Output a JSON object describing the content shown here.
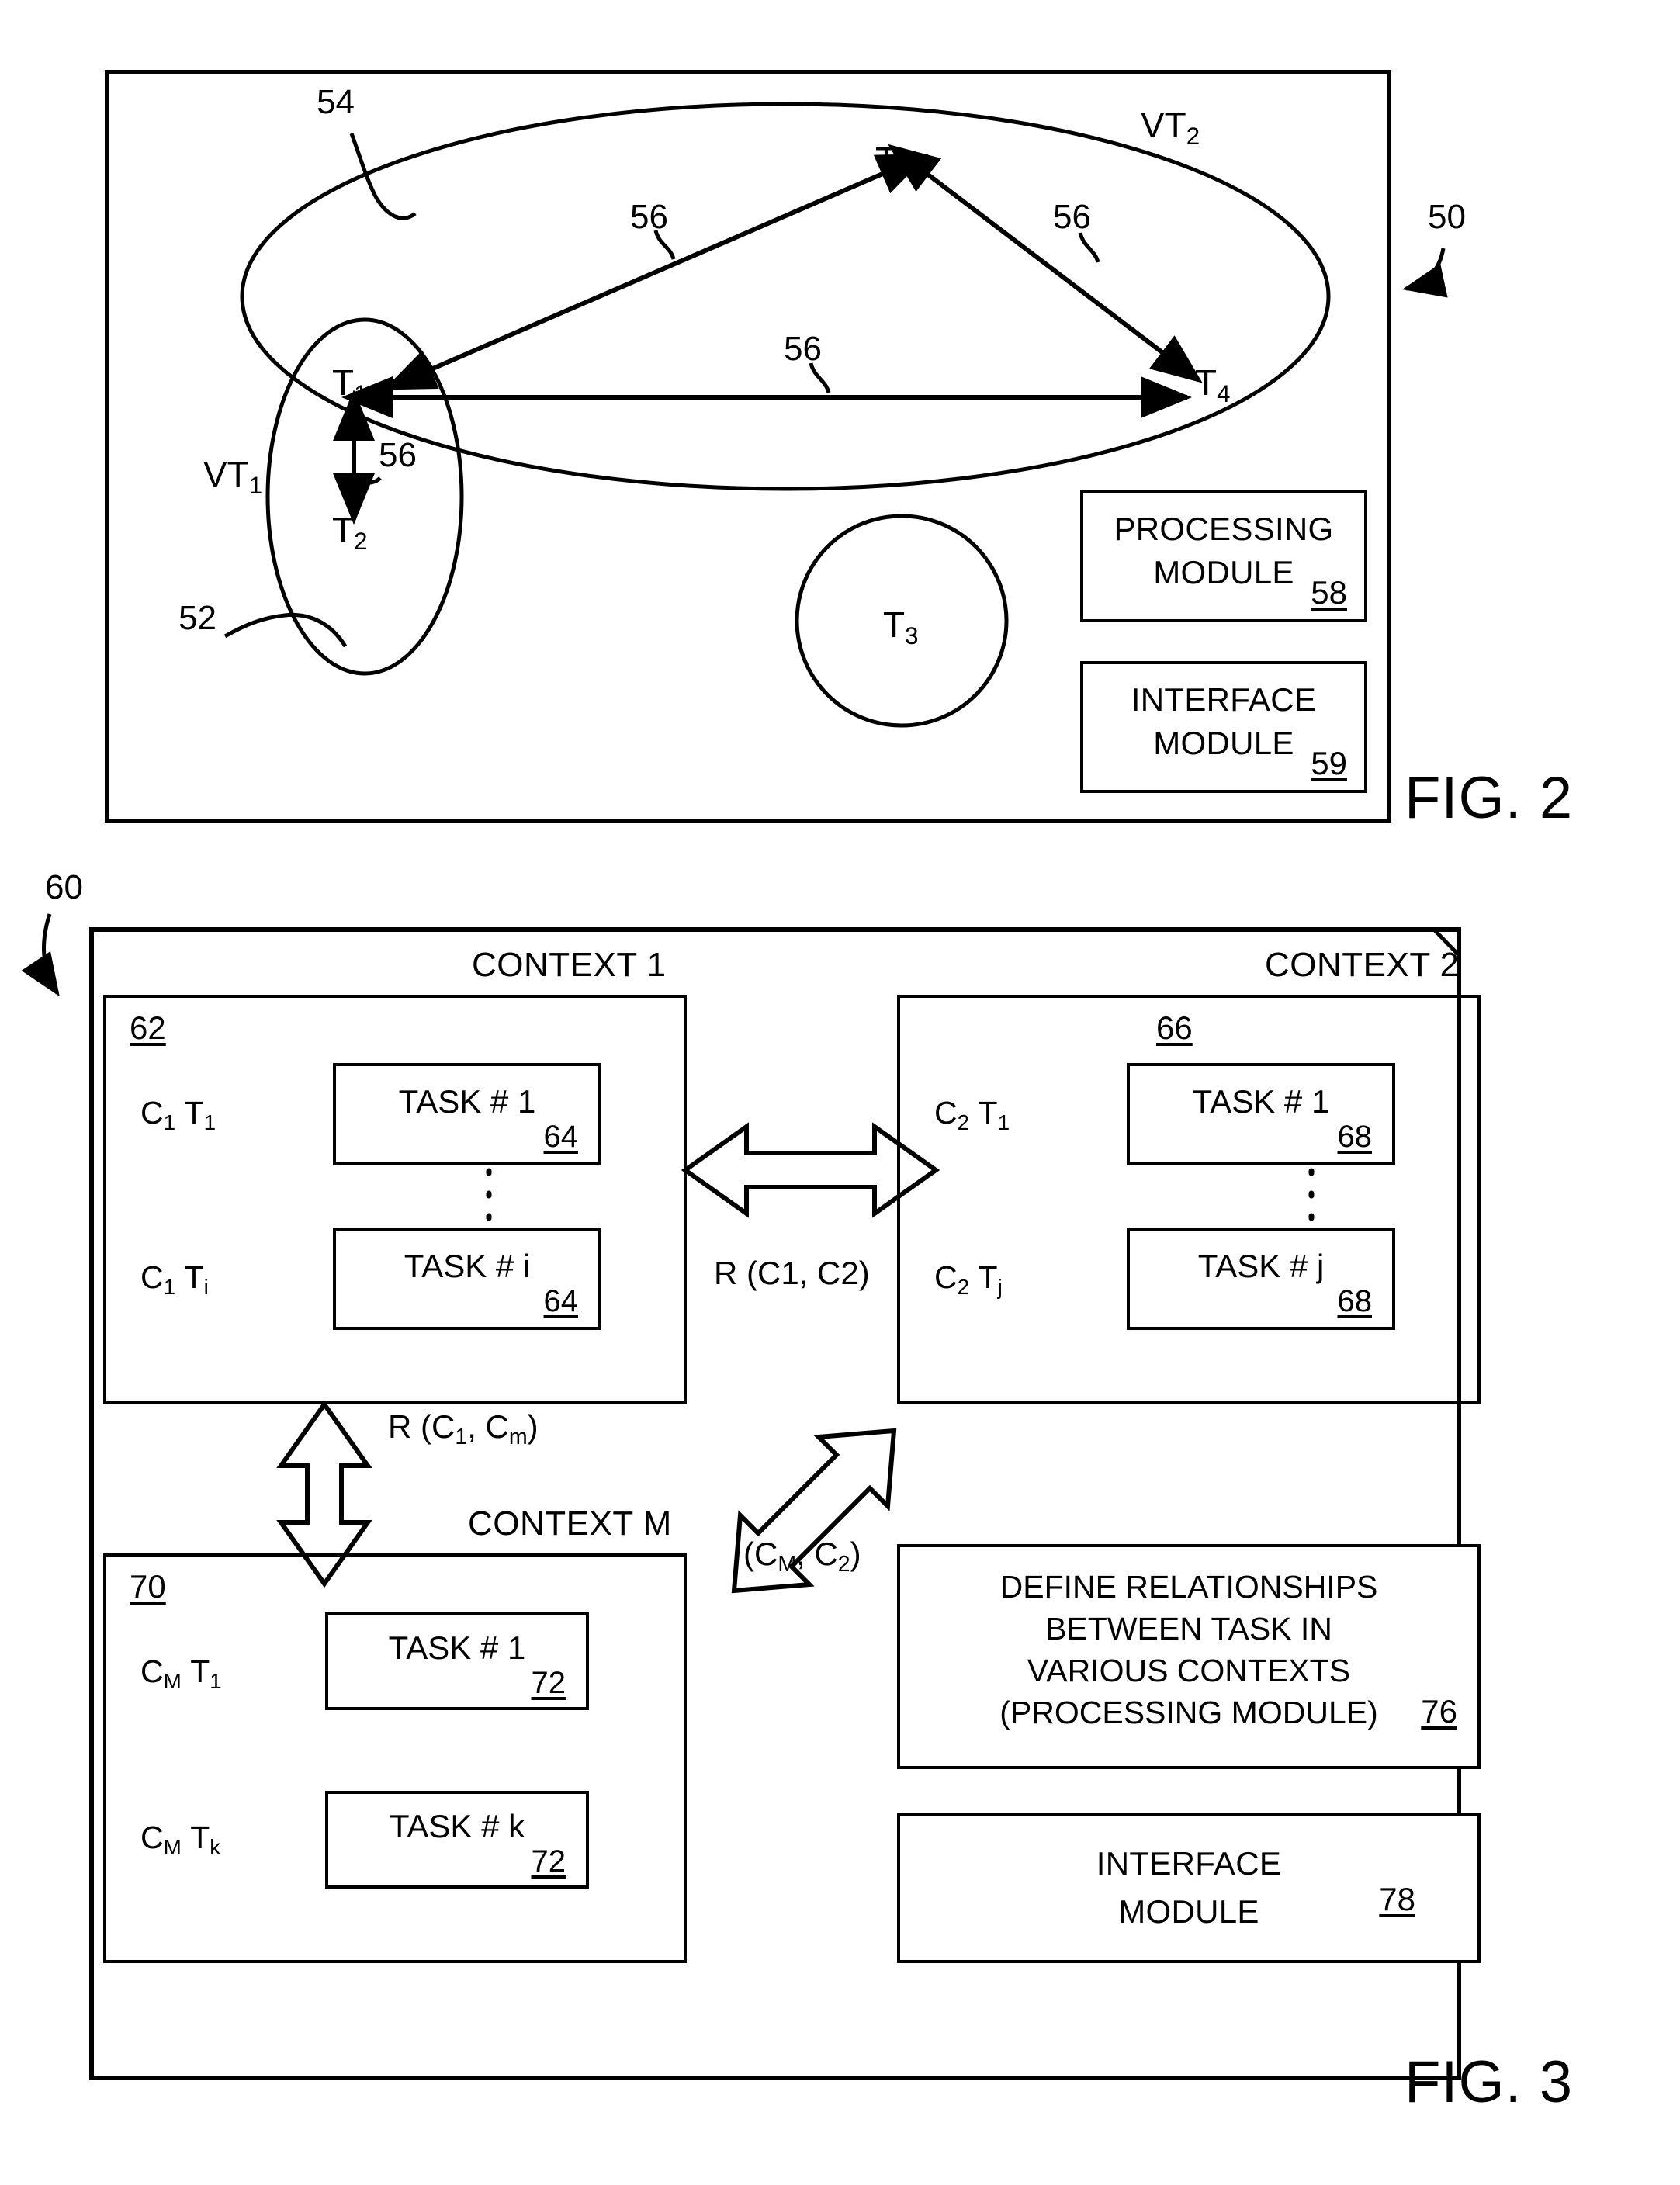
{
  "figures": [
    {
      "id": "fig2",
      "caption": "FIG. 2",
      "system_ref": "50",
      "ellipse_large_ref": "54",
      "ellipse_small_ref": "52",
      "group_labels": {
        "vt1": "VT",
        "vt1_sub": "1",
        "vt2": "VT",
        "vt2_sub": "2"
      },
      "nodes": [
        {
          "name": "T",
          "sub": "N"
        },
        {
          "name": "T",
          "sub": "1"
        },
        {
          "name": "T",
          "sub": "2"
        },
        {
          "name": "T",
          "sub": "3"
        },
        {
          "name": "T",
          "sub": "4"
        }
      ],
      "relation_refs": [
        "56",
        "56",
        "56",
        "56"
      ],
      "modules": [
        {
          "line1": "PROCESSING",
          "line2": "MODULE",
          "ref": "58"
        },
        {
          "line1": "INTERFACE",
          "line2": "MODULE",
          "ref": "59"
        }
      ]
    },
    {
      "id": "fig3",
      "caption": "FIG. 3",
      "system_ref": "60",
      "contexts": [
        {
          "title": "CONTEXT 1",
          "ref": "62",
          "rows": [
            {
              "label_c": "C",
              "label_c_sub": "1",
              "label_t": "T",
              "label_t_sub": "1",
              "task": "TASK # 1",
              "task_ref": "64"
            },
            {
              "label_c": "C",
              "label_c_sub": "1",
              "label_t": "T",
              "label_t_sub": "i",
              "task": "TASK # i",
              "task_ref": "64"
            }
          ]
        },
        {
          "title": "CONTEXT 2",
          "ref": "66",
          "rows": [
            {
              "label_c": "C",
              "label_c_sub": "2",
              "label_t": "T",
              "label_t_sub": "1",
              "task": "TASK # 1",
              "task_ref": "68"
            },
            {
              "label_c": "C",
              "label_c_sub": "2",
              "label_t": "T",
              "label_t_sub": "j",
              "task": "TASK # j",
              "task_ref": "68"
            }
          ]
        },
        {
          "title": "CONTEXT M",
          "ref": "70",
          "rows": [
            {
              "label_c": "C",
              "label_c_sub": "M",
              "label_t": "T",
              "label_t_sub": "1",
              "task": "TASK # 1",
              "task_ref": "72"
            },
            {
              "label_c": "C",
              "label_c_sub": "M",
              "label_t": "T",
              "label_t_sub": "k",
              "task": "TASK # k",
              "task_ref": "72"
            }
          ]
        }
      ],
      "relations": [
        {
          "id": "r-c1-c2",
          "text": "R (C1, C2)"
        },
        {
          "id": "r-c1-cm",
          "prefix": "R (C",
          "sub1": "1",
          "mid": ", C",
          "sub2": "m",
          "suffix": ")"
        },
        {
          "id": "r-cm-c2",
          "prefix": "(C",
          "sub1": "M",
          "mid": ", C",
          "sub2": "2",
          "suffix": ")"
        }
      ],
      "modules": [
        {
          "lines": [
            "DEFINE RELATIONSHIPS",
            "BETWEEN TASK IN",
            "VARIOUS CONTEXTS",
            "(PROCESSING MODULE)"
          ],
          "ref": "76"
        },
        {
          "lines": [
            "INTERFACE",
            "MODULE"
          ],
          "ref": "78"
        }
      ]
    }
  ]
}
